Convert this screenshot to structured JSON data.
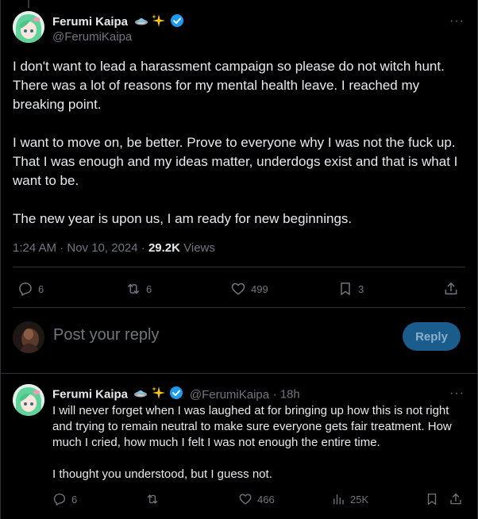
{
  "main_tweet": {
    "author_name": "Ferumi Kaipa",
    "handle": "@FerumiKaipa",
    "paragraphs": [
      "I don't want to lead a harassment campaign so please do not witch hunt. There was a lot of reasons for my mental health leave. I reached my breaking point.",
      "I want to move on, be better. Prove to everyone why I was not the fuck up. That I was enough and my ideas matter, underdogs exist and that is what I want to be.",
      "The new year is upon us, I am ready for new beginnings."
    ],
    "timestamp": "1:24 AM · Nov 10, 2024 · ",
    "views_count": "29.2K",
    "views_label": " Views",
    "actions": {
      "replies": "6",
      "reposts": "6",
      "likes": "499",
      "bookmarks": "3"
    }
  },
  "composer": {
    "placeholder": "Post your reply",
    "button_label": "Reply"
  },
  "reply_tweet": {
    "author_name": "Ferumi Kaipa",
    "handle": "@FerumiKaipa",
    "time": "· 18h",
    "paragraphs": [
      "I will never forget when I was laughed at for bringing up how this is not right and trying to remain neutral to make sure everyone gets fair treatment. How much I cried, how much I felt I was not enough the entire time.",
      "I thought you understood, but I guess not."
    ],
    "actions": {
      "replies": "6",
      "reposts": "",
      "likes": "466",
      "views": "25K"
    }
  },
  "colors": {
    "background": "#000000",
    "text": "#e7e9ea",
    "muted": "#71767b",
    "verified": "#1d9bf0",
    "reply_button": "#1a5c8c",
    "divider": "#2f3336"
  }
}
